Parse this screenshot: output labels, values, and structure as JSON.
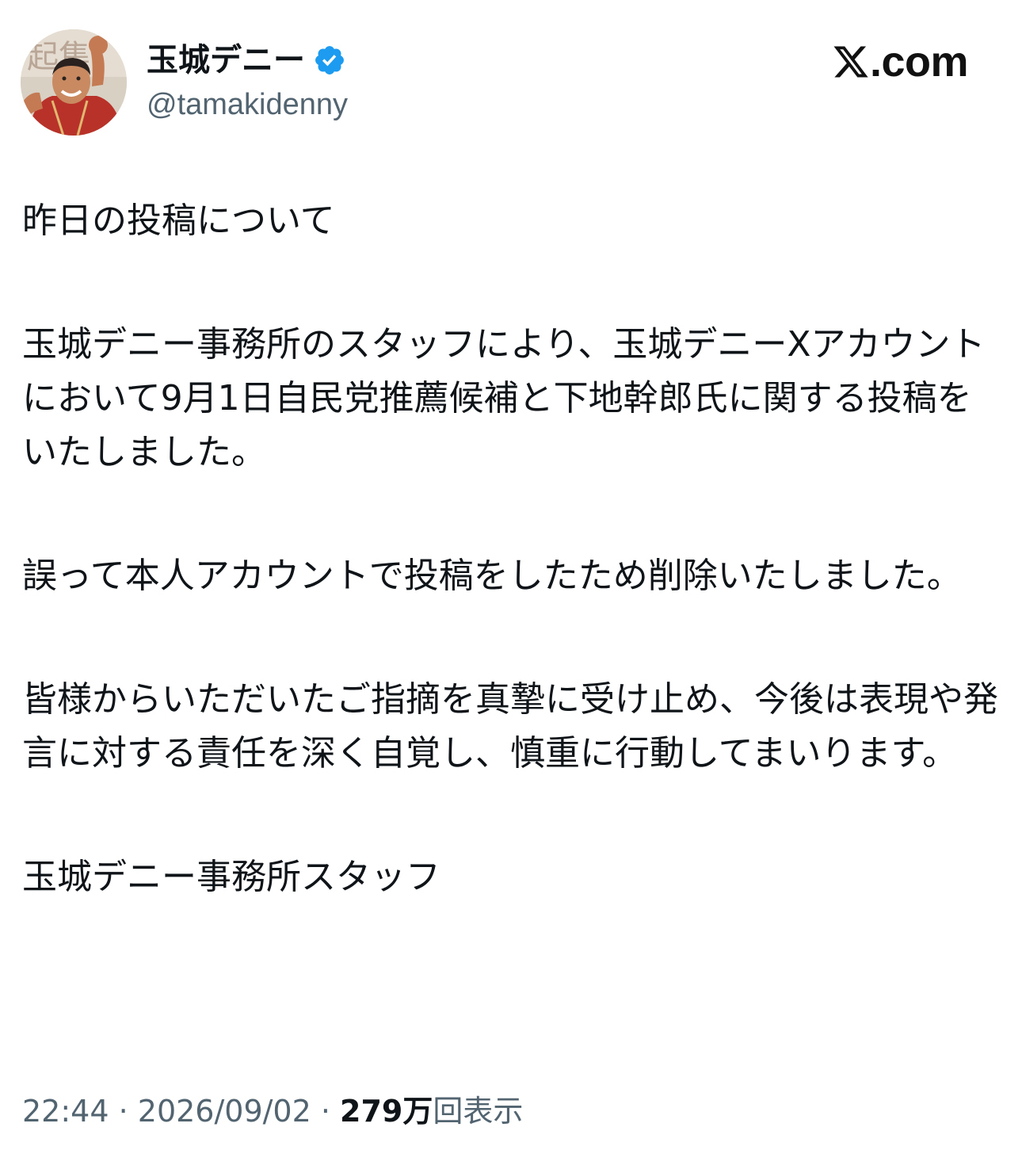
{
  "colors": {
    "text_primary": "#0f1419",
    "text_secondary": "#536471",
    "verified_blue": "#1d9bf0",
    "background": "#ffffff"
  },
  "header": {
    "display_name": "玉城デニー",
    "handle": "@tamakidenny",
    "verified_icon": "verified-badge-icon",
    "site_domain": ".com",
    "site_icon": "x-logo-icon"
  },
  "body": {
    "paragraphs": [
      "昨日の投稿について",
      "玉城デニー事務所のスタッフにより、玉城デニーXアカウントにおいて9月1日自民党推薦候補と下地幹郎氏に関する投稿をいたしました。",
      "誤って本人アカウントで投稿をしたため削除いたしました。",
      "皆様からいただいたご指摘を真摯に受け止め、今後は表現や発言に対する責任を深く自覚し、慎重に行動してまいります。",
      "玉城デニー事務所スタッフ"
    ]
  },
  "footer": {
    "time": "22:44",
    "separator": " · ",
    "date": "2026/09/02",
    "views_count": "279万",
    "views_label": "回表示"
  }
}
